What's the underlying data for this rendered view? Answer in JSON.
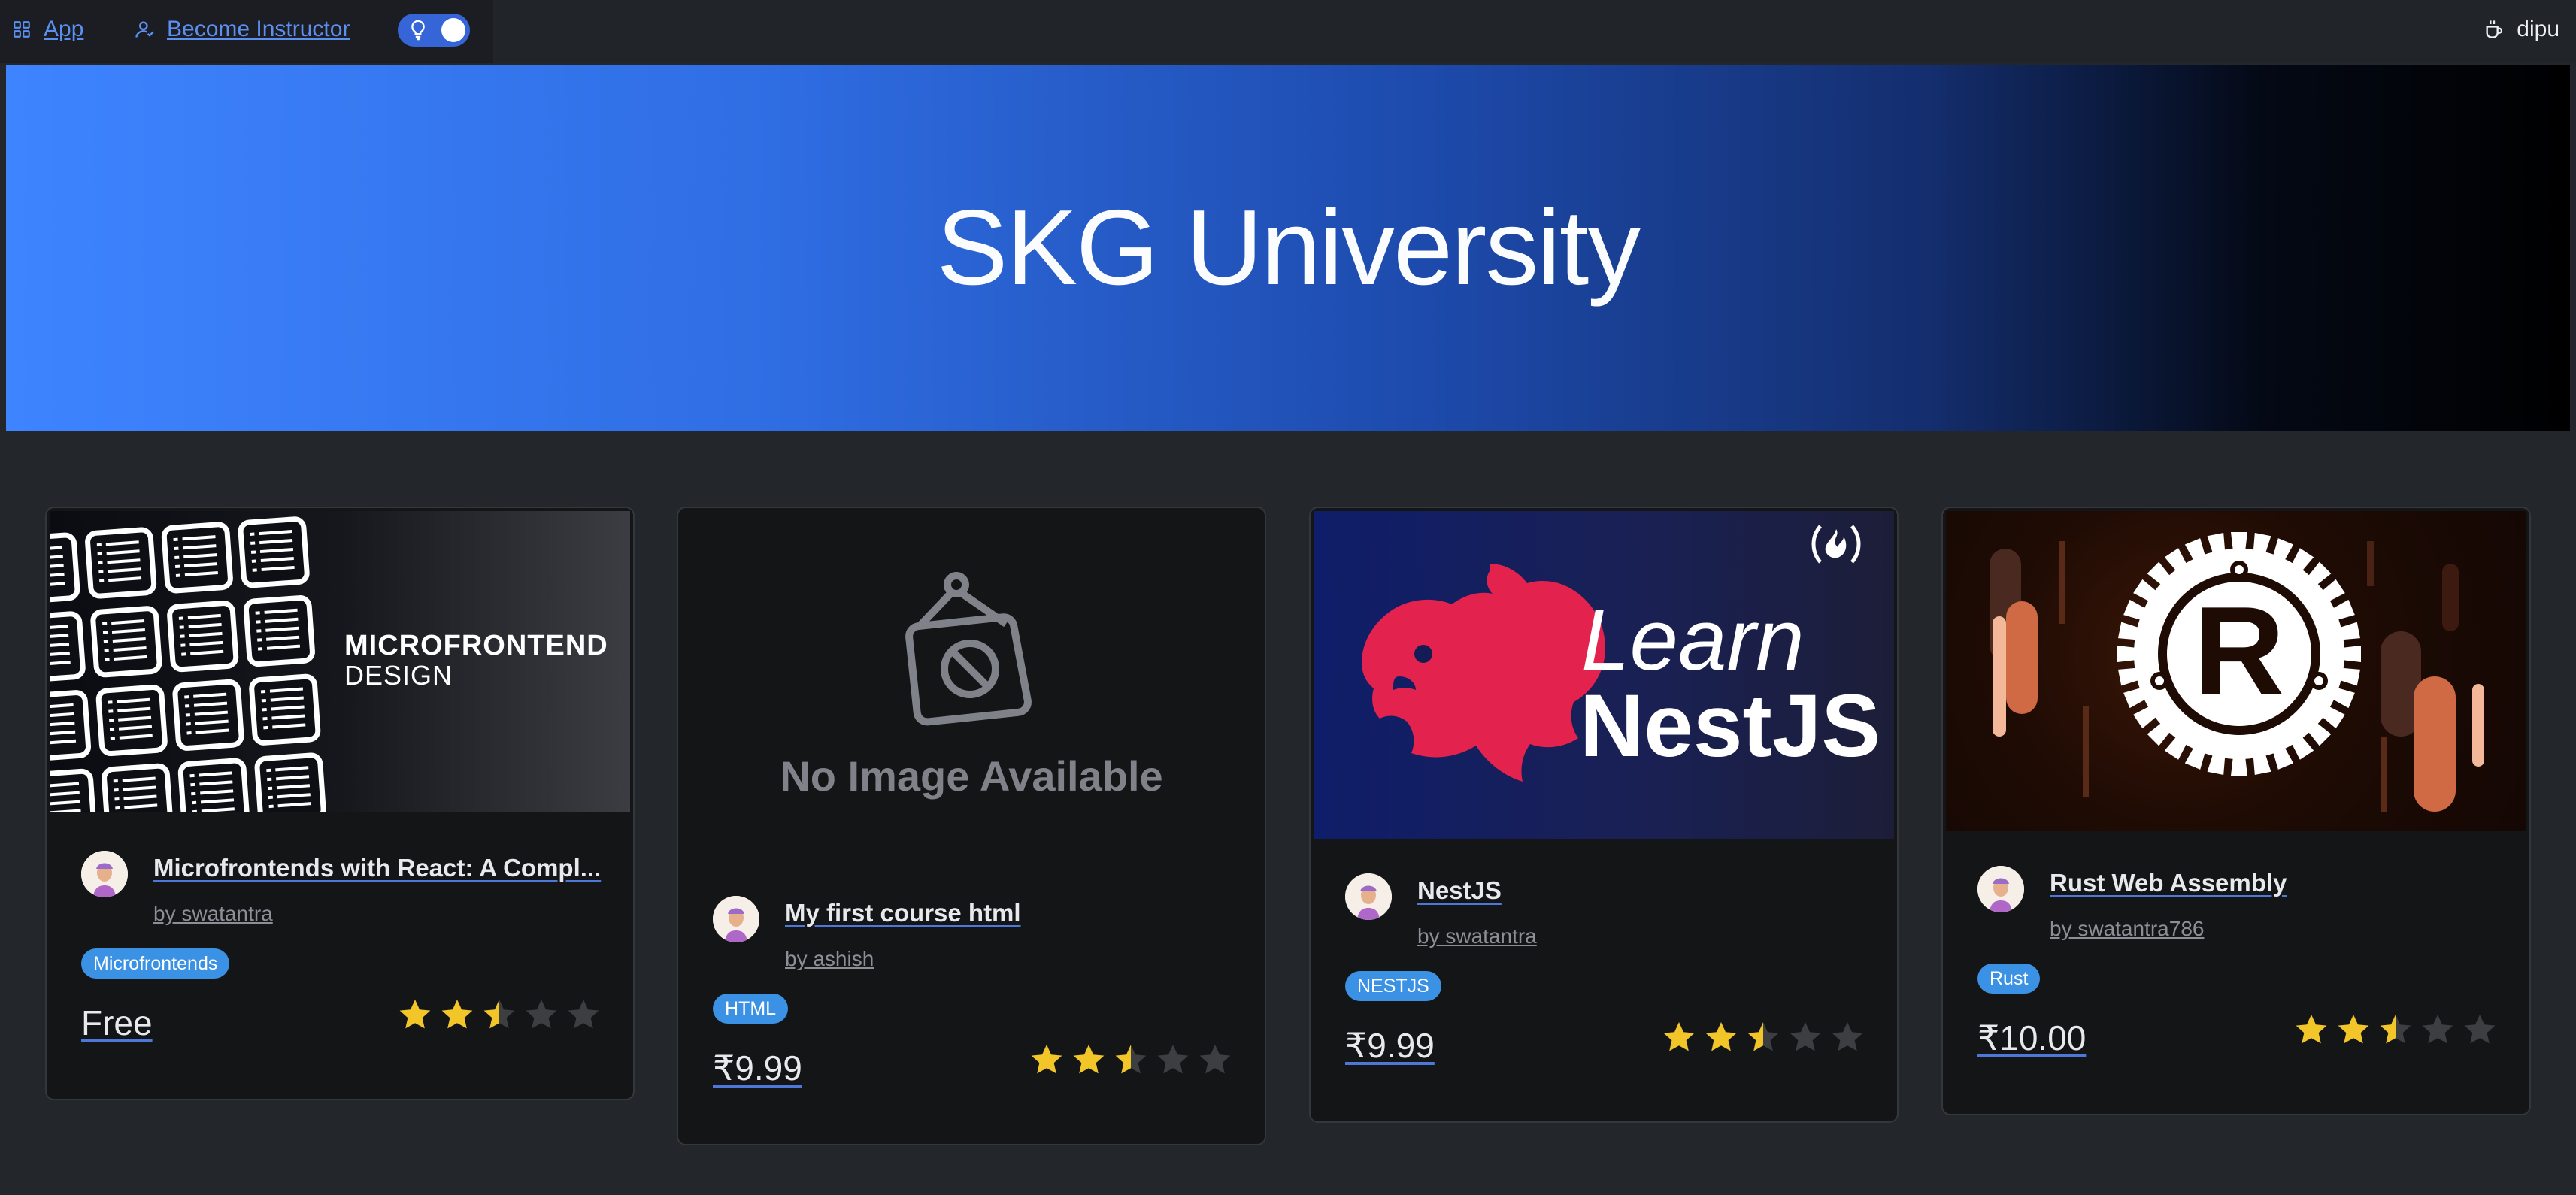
{
  "nav": {
    "app_label": "App",
    "instructor_label": "Become Instructor",
    "theme_toggle_icon": "lightbulb-icon",
    "user_icon": "coffee-cup-icon",
    "user_name": "dipu"
  },
  "hero": {
    "title": "SKG University"
  },
  "colors": {
    "accent": "#3b92e4",
    "star": "#f2c529",
    "star_empty": "#3c3e42",
    "link_underline": "#4d78d9"
  },
  "courses": [
    {
      "image_text_line1": "MICROFRONTEND",
      "image_text_line2": "DESIGN",
      "title": "Microfrontends with React: A Compl...",
      "author": "by swatantra",
      "tag": "Microfrontends",
      "price": "Free",
      "rating": 2.5
    },
    {
      "image_placeholder": "No Image Available",
      "title": "My first course html",
      "author": "by ashish",
      "tag": "HTML",
      "price": "₹9.99",
      "rating": 2.5
    },
    {
      "image_text_line1": "Learn",
      "image_text_line2": "NestJS",
      "title": "NestJS",
      "author": "by swatantra",
      "tag": "NESTJS",
      "price": "₹9.99",
      "rating": 2.5
    },
    {
      "image_logo_letter": "R",
      "title": "Rust Web Assembly",
      "author": "by swatantra786",
      "tag": "Rust",
      "price": "₹10.00",
      "rating": 2.5
    }
  ]
}
